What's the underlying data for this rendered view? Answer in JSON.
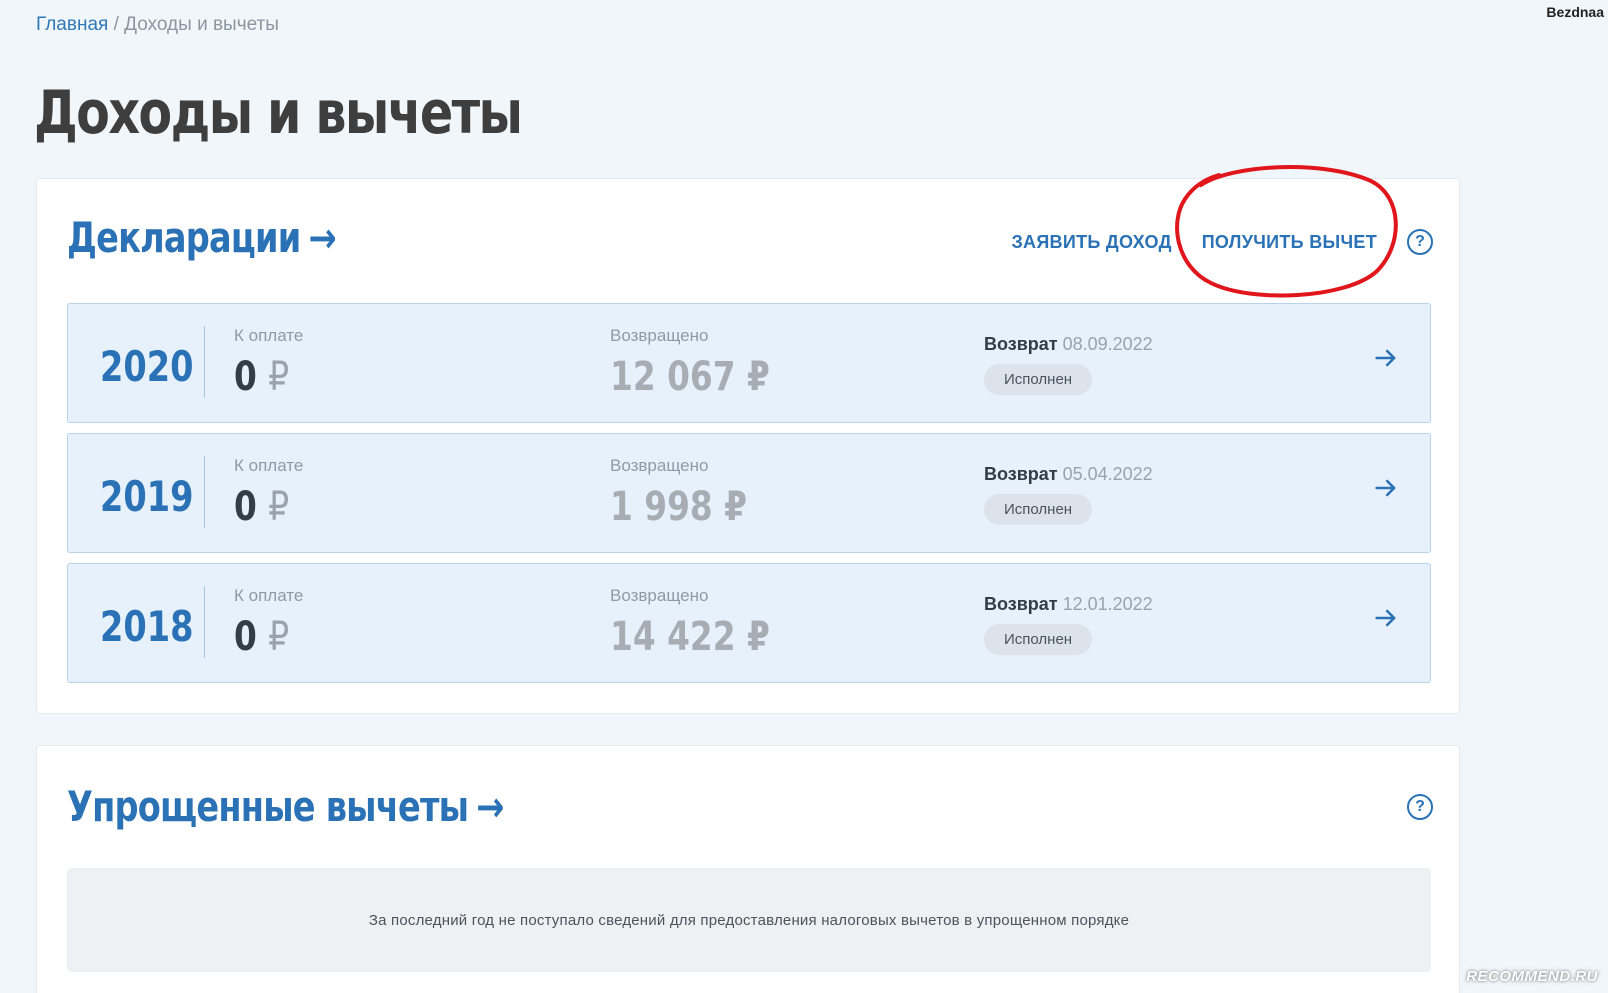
{
  "watermark_user": "Bezdnaa",
  "breadcrumb": {
    "home": "Главная",
    "separator": " / ",
    "current": "Доходы и вычеты"
  },
  "page_title": "Доходы и вычеты",
  "declarations": {
    "title": "Декларации",
    "actions": {
      "declare_income": "ЗАЯВИТЬ ДОХОД",
      "get_deduction": "ПОЛУЧИТЬ ВЫЧЕТ"
    },
    "help": "?",
    "pay_label": "К оплате",
    "returned_label": "Возвращено",
    "rows": [
      {
        "year": "2020",
        "pay": "0",
        "returned": "12 067",
        "kind": "Возврат",
        "date": "08.09.2022",
        "status": "Исполнен"
      },
      {
        "year": "2019",
        "pay": "0",
        "returned": "1 998",
        "kind": "Возврат",
        "date": "05.04.2022",
        "status": "Исполнен"
      },
      {
        "year": "2018",
        "pay": "0",
        "returned": "14 422",
        "kind": "Возврат",
        "date": "12.01.2022",
        "status": "Исполнен"
      }
    ],
    "currency": "₽"
  },
  "simplified": {
    "title": "Упрощенные вычеты",
    "help": "?",
    "empty_text": "За последний год не поступало сведений для предоставления налоговых вычетов в упрощенном порядке"
  },
  "site_watermark": "RECOMMEND.RU",
  "colors": {
    "accent": "#2a72b5",
    "highlight": "#e0161c",
    "row_bg": "#e6f1fb"
  }
}
